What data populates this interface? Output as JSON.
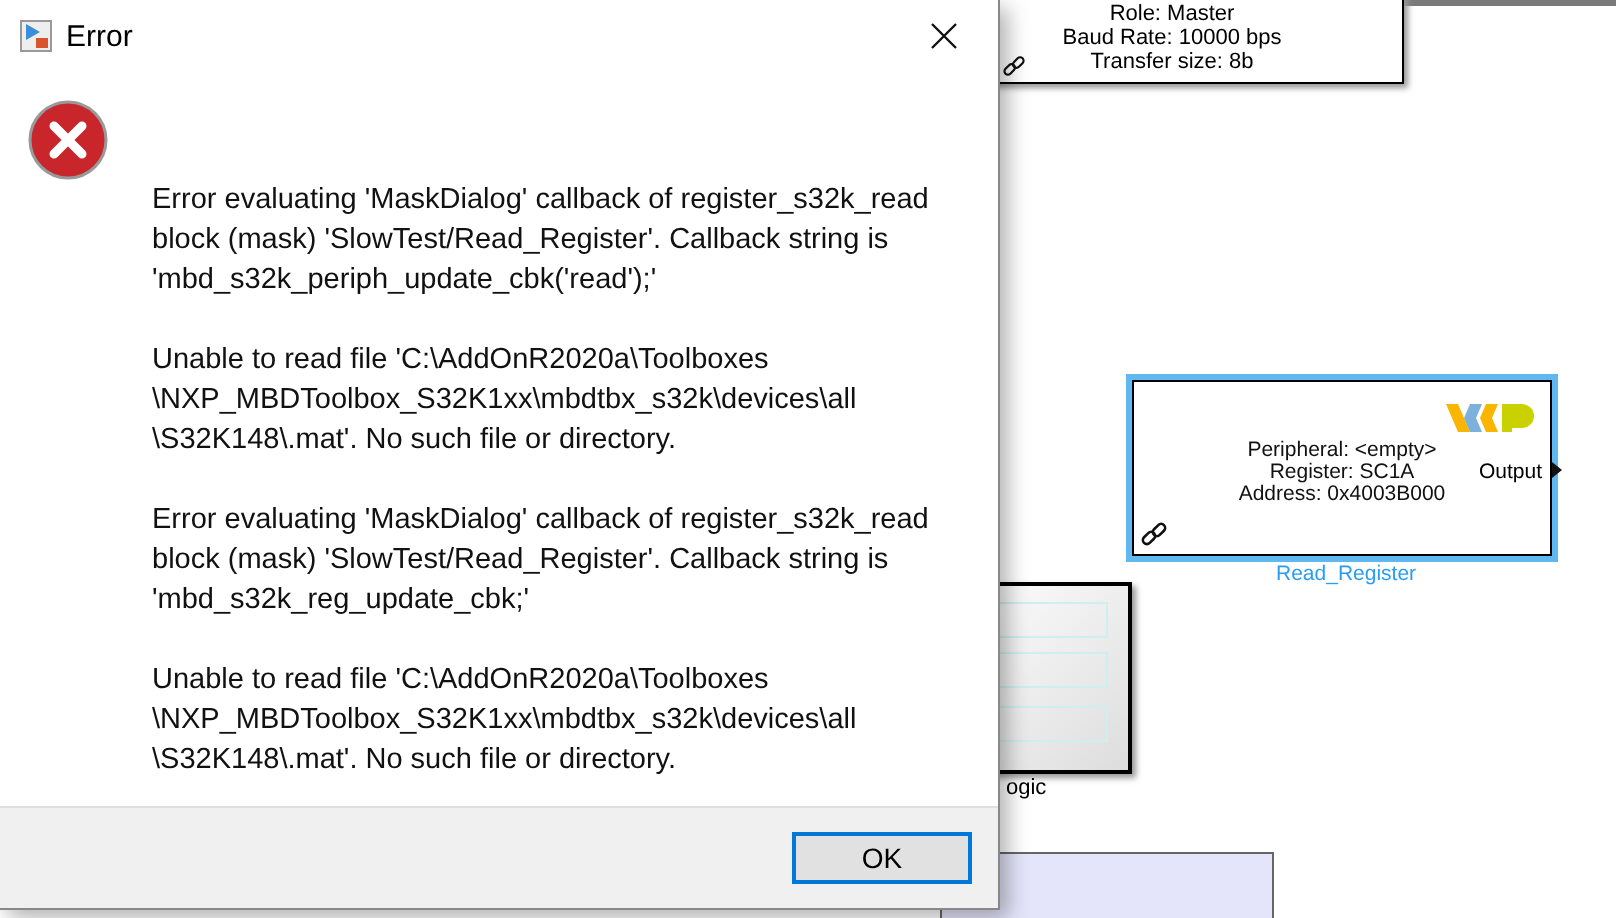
{
  "canvas": {
    "top_block": {
      "lines": [
        "Role: Master",
        "Baud Rate: 10000 bps",
        "Transfer size: 8b"
      ]
    },
    "register_block": {
      "lines": [
        "Peripheral: <empty>",
        "Register: SC1A",
        "Address: 0x4003B000"
      ],
      "port": "Output",
      "label": "Read_Register",
      "selected": true
    },
    "logic_block": {
      "label": "ogic"
    }
  },
  "dialog": {
    "title": "Error",
    "paragraphs": [
      [
        "Error evaluating 'MaskDialog' callback of register_s32k_read",
        "block (mask) 'SlowTest/Read_Register'. Callback string is",
        "'mbd_s32k_periph_update_cbk('read');'"
      ],
      [
        "Unable to read file 'C:\\AddOnR2020a\\Toolboxes",
        "\\NXP_MBDToolbox_S32K1xx\\mbdtbx_s32k\\devices\\all",
        "\\S32K148\\.mat'. No such file or directory."
      ],
      [
        "Error evaluating 'MaskDialog' callback of register_s32k_read",
        "block (mask) 'SlowTest/Read_Register'. Callback string is",
        "'mbd_s32k_reg_update_cbk;'"
      ],
      [
        "Unable to read file 'C:\\AddOnR2020a\\Toolboxes",
        "\\NXP_MBDToolbox_S32K1xx\\mbdtbx_s32k\\devices\\all",
        "\\S32K148\\.mat'. No such file or directory."
      ]
    ],
    "ok_button": "OK"
  }
}
